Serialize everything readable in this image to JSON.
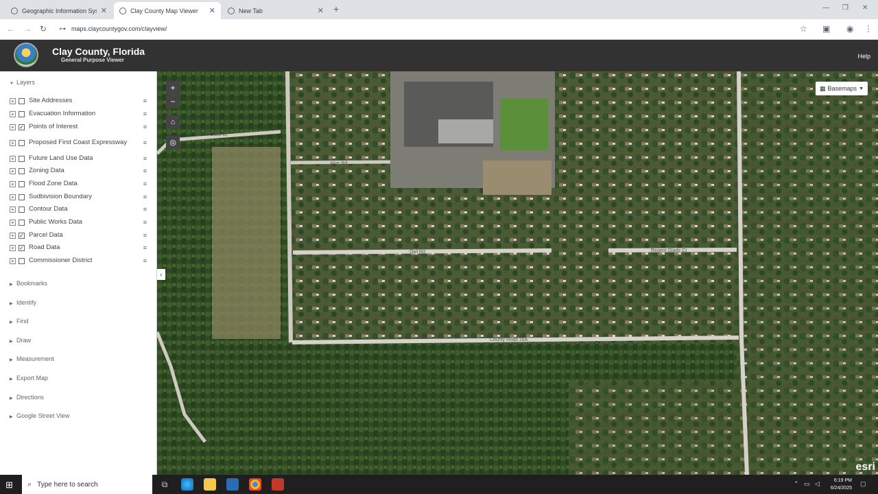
{
  "browser": {
    "tabs": [
      {
        "title": "Geographic Information Syste",
        "active": false
      },
      {
        "title": "Clay County Map Viewer",
        "active": true
      },
      {
        "title": "New Tab",
        "active": false
      }
    ],
    "url": "maps.claycountygov.com/clayview/"
  },
  "app": {
    "title": "Clay County, Florida",
    "subtitle": "General Purpose Viewer",
    "help": "Help"
  },
  "sidebar": {
    "layers_header": "Layers",
    "layers": [
      {
        "name": "Site Addresses",
        "checked": false
      },
      {
        "name": "Evacuation Information",
        "checked": false
      },
      {
        "name": "Points of Interest",
        "checked": true
      },
      {
        "name": "Proposed First Coast Expressway",
        "checked": false
      },
      {
        "name": "Future Land Use Data",
        "checked": false
      },
      {
        "name": "Zoning Data",
        "checked": false
      },
      {
        "name": "Flood Zone Data",
        "checked": false
      },
      {
        "name": "Sudbivision Boundary",
        "checked": false
      },
      {
        "name": "Contour Data",
        "checked": false
      },
      {
        "name": "Public Works Data",
        "checked": false
      },
      {
        "name": "Parcel Data",
        "checked": true
      },
      {
        "name": "Road Data",
        "checked": true
      },
      {
        "name": "Commissioner District",
        "checked": false
      }
    ],
    "sections": [
      "Bookmarks",
      "Identify",
      "Find",
      "Draw",
      "Measurement",
      "Export Map",
      "Directions",
      "Google Street View"
    ]
  },
  "map": {
    "basemaps_label": "Basemaps",
    "attribution": "esri",
    "road_labels": [
      "Huntel Oaks Dr",
      "Aker Rd",
      "Owl Rd",
      "Regent Glade Ct",
      "County Road 16A"
    ]
  },
  "taskbar": {
    "search_placeholder": "Type here to search",
    "time": "6:19 PM",
    "date": "6/24/2025"
  }
}
